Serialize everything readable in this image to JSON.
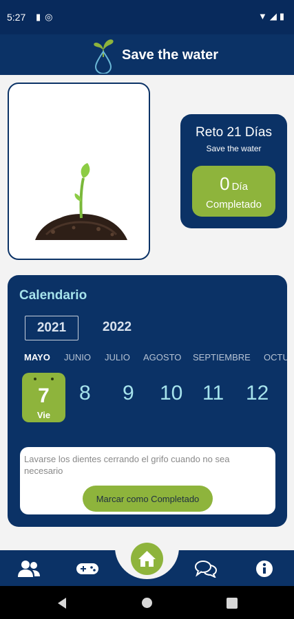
{
  "status_bar": {
    "time": "5:27",
    "left_icons": [
      "sd-card-icon",
      "notification-icon"
    ],
    "right_icons": [
      "wifi-icon",
      "signal-icon",
      "battery-icon"
    ]
  },
  "header": {
    "title": "Save the water",
    "logo_icon": "sprout-drop-logo"
  },
  "plant_card": {
    "image": "sprout-in-soil-illustration"
  },
  "challenge": {
    "title": "Reto 21 Días",
    "subtitle": "Save the water",
    "count": "0",
    "day_word": "Día",
    "completed_label": "Completado"
  },
  "calendar": {
    "title": "Calendario",
    "years": [
      "2021",
      "2022"
    ],
    "selected_year": "2021",
    "months": [
      "MAYO",
      "JUNIO",
      "JULIO",
      "AGOSTO",
      "SEPTIEMBRE",
      "OCTU"
    ],
    "selected_month": "MAYO",
    "selected_day": {
      "number": "7",
      "weekday": "Vie"
    },
    "days": [
      "8",
      "9",
      "10",
      "11",
      "12"
    ],
    "task": {
      "text": "Lavarse los dientes cerrando el grifo cuando no sea necesario",
      "button_label": "Marcar como Completado"
    }
  },
  "bottom_nav": {
    "items": [
      "users-icon",
      "gamepad-icon",
      "home-icon",
      "chat-icon",
      "info-icon"
    ],
    "active": "home-icon"
  },
  "colors": {
    "navy": "#0b3266",
    "status_bar": "#082a5c",
    "green": "#8eb43c",
    "calendar_accent": "#a6e3ec",
    "background": "#f3f3f3"
  }
}
